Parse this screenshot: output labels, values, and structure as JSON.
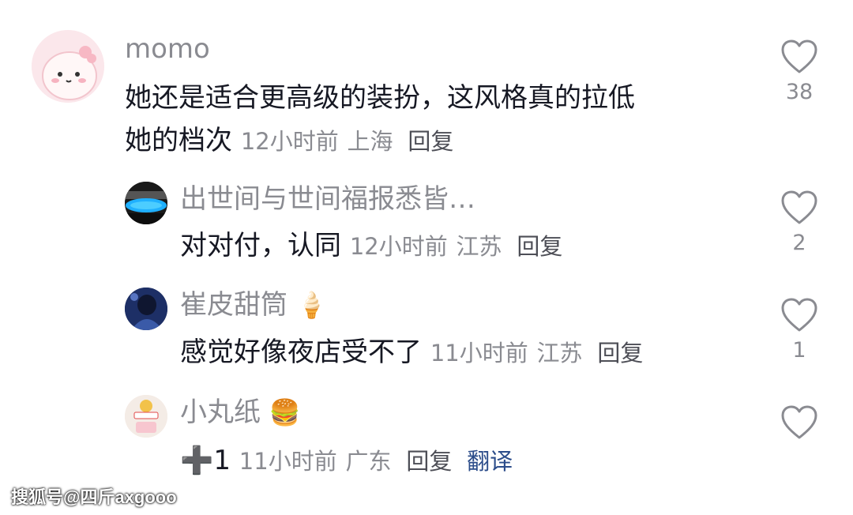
{
  "comments": [
    {
      "username": "momo",
      "text_line1": "她还是适合更高级的装扮，这风格真的拉低",
      "text_line2": "她的档次",
      "time": "12小时前",
      "location": "上海",
      "reply_label": "回复",
      "likes": "38",
      "avatar": "pink-cartoon-avatar"
    },
    {
      "username": "出世间与世间福报悉皆…",
      "text": "对对付，认同",
      "time": "12小时前",
      "location": "江苏",
      "reply_label": "回复",
      "likes": "2",
      "avatar": "blue-aquarium-avatar"
    },
    {
      "username": "崔皮甜筒",
      "username_emoji": "🍦",
      "text": "感觉好像夜店受不了",
      "time": "11小时前",
      "location": "江苏",
      "reply_label": "回复",
      "likes": "1",
      "avatar": "dark-photo-avatar"
    },
    {
      "username": "小丸纸",
      "username_emoji": "🍔",
      "text_emoji": "➕",
      "text": "1",
      "time": "11小时前",
      "location": "广东",
      "reply_label": "回复",
      "translate_label": "翻译",
      "likes": "",
      "avatar": "sticker-avatar"
    }
  ],
  "watermark": "搜狐号@四斤axgooo",
  "colors": {
    "meta": "#8a8b91",
    "text": "#161823",
    "translate": "#2b4c8a"
  }
}
